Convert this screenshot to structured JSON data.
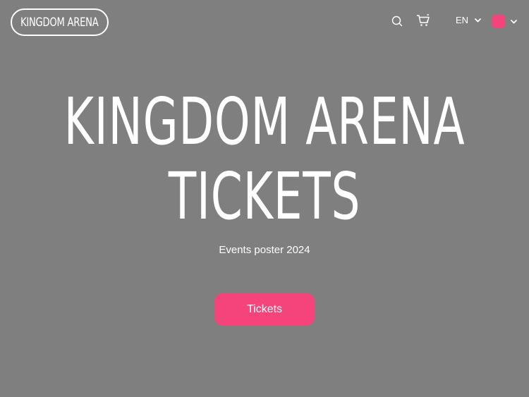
{
  "header": {
    "logo_text": "KINGDOM ARENA",
    "language": "EN",
    "icons": [
      "search-icon",
      "cart-icon",
      "chevron-down-icon"
    ],
    "theme_color": "#f5437b"
  },
  "hero": {
    "title_line_1": "KINGDOM ARENA",
    "title_line_2": "TICKETS",
    "subtitle": "Events poster 2024",
    "cta_label": "Tickets"
  },
  "colors": {
    "background": "#7f7f7f",
    "accent": "#f5437b",
    "text": "#ffffff"
  }
}
